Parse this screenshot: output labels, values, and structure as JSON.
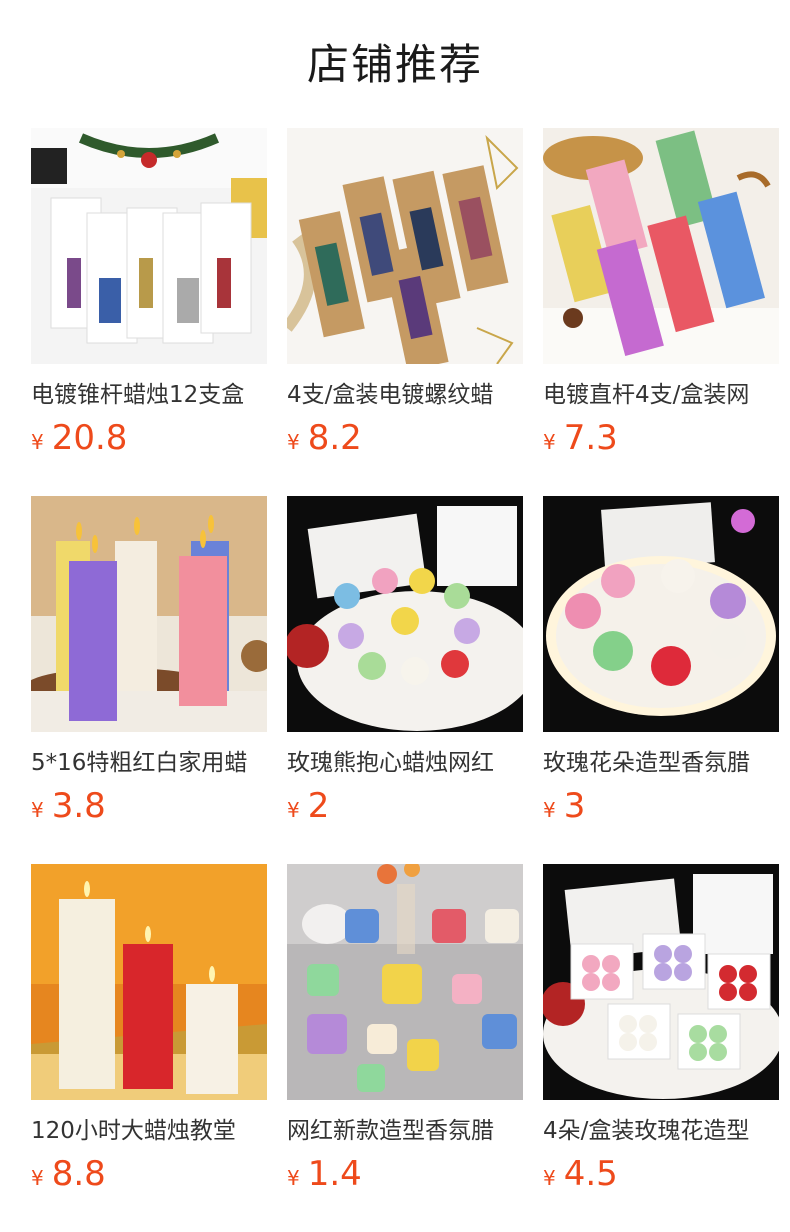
{
  "page": {
    "title": "店铺推荐"
  },
  "colors": {
    "price": "#ee4a1b",
    "title": "#1a1a1a",
    "name": "#333333"
  },
  "products": [
    {
      "name": "电镀锥杆蜡烛12支盒",
      "currency": "¥",
      "price": "20.8",
      "image": "taper-candle-gift-boxes"
    },
    {
      "name": "4支/盒装电镀螺纹蜡",
      "currency": "¥",
      "price": "8.2",
      "image": "spiral-taper-candle-kraft-boxes"
    },
    {
      "name": "电镀直杆4支/盒装网",
      "currency": "¥",
      "price": "7.3",
      "image": "classic-straight-taper-packs"
    },
    {
      "name": "5*16特粗红白家用蜡",
      "currency": "¥",
      "price": "3.8",
      "image": "pillar-candles"
    },
    {
      "name": "玫瑰熊抱心蜡烛网红",
      "currency": "¥",
      "price": "2",
      "image": "bear-candles-on-plate"
    },
    {
      "name": "玫瑰花朵造型香氛腊",
      "currency": "¥",
      "price": "3",
      "image": "rose-candles-on-lit-tray"
    },
    {
      "name": "120小时大蜡烛教堂",
      "currency": "¥",
      "price": "8.8",
      "image": "large-church-pillar-candles"
    },
    {
      "name": "网红新款造型香氛腊",
      "currency": "¥",
      "price": "1.4",
      "image": "bubble-cube-candles"
    },
    {
      "name": "4朵/盒装玫瑰花造型",
      "currency": "¥",
      "price": "4.5",
      "image": "boxed-rose-candles"
    }
  ]
}
